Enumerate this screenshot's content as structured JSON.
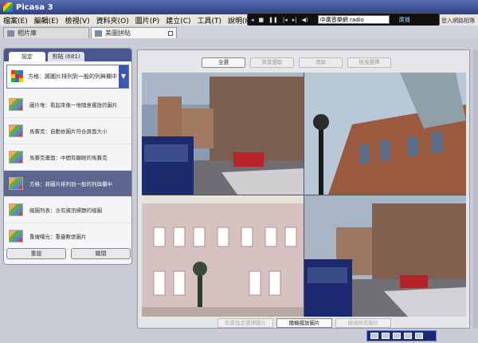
{
  "window": {
    "title": "Picasa 3"
  },
  "menu": [
    "檔案(E)",
    "編輯(E)",
    "檢視(V)",
    "資料夾(O)",
    "圖片(P)",
    "建立(C)",
    "工具(T)",
    "說明(H)"
  ],
  "media_bar": {
    "prev": "◂",
    "stop": "■",
    "pause": "❚❚",
    "back": "|◂",
    "fwd": "▸|",
    "vol": "◀)",
    "station": "中廣音樂網 radio",
    "go": "廣播"
  },
  "login_link": "登入網路相簿",
  "tabs": [
    {
      "label": "相片庫"
    },
    {
      "label": "美圖拼貼"
    }
  ],
  "sidebar": {
    "tabs": [
      "設定",
      "剪貼 (681)"
    ],
    "selected_layout": "方格：將圖片排列到一般的列與欄中",
    "items": [
      {
        "label": "圖片堆：看起來像一堆隨意擺放的圖片"
      },
      {
        "label": "馬賽克：自動依圖片符合頁面大小"
      },
      {
        "label": "馬賽克畫面：中間有顯眼的馬賽克"
      },
      {
        "label": "方格：將圖片排列到一般的列與欄中"
      },
      {
        "label": "縮圖列表：含有資訊標題的縮圖"
      },
      {
        "label": "重複曝光：重疊數張圖片"
      }
    ],
    "btn_reset": "重設",
    "btn_close": "關閉"
  },
  "main": {
    "top_buttons": [
      "全選",
      "背景選取",
      "清除",
      "拖曳選擇"
    ],
    "bottom_buttons": [
      "背景設定選擇圖片",
      "隨機擺放圖片",
      "檢視所有圖片"
    ]
  },
  "colors": {
    "title_bar": "#2f3f86",
    "selection": "#5d668f"
  }
}
